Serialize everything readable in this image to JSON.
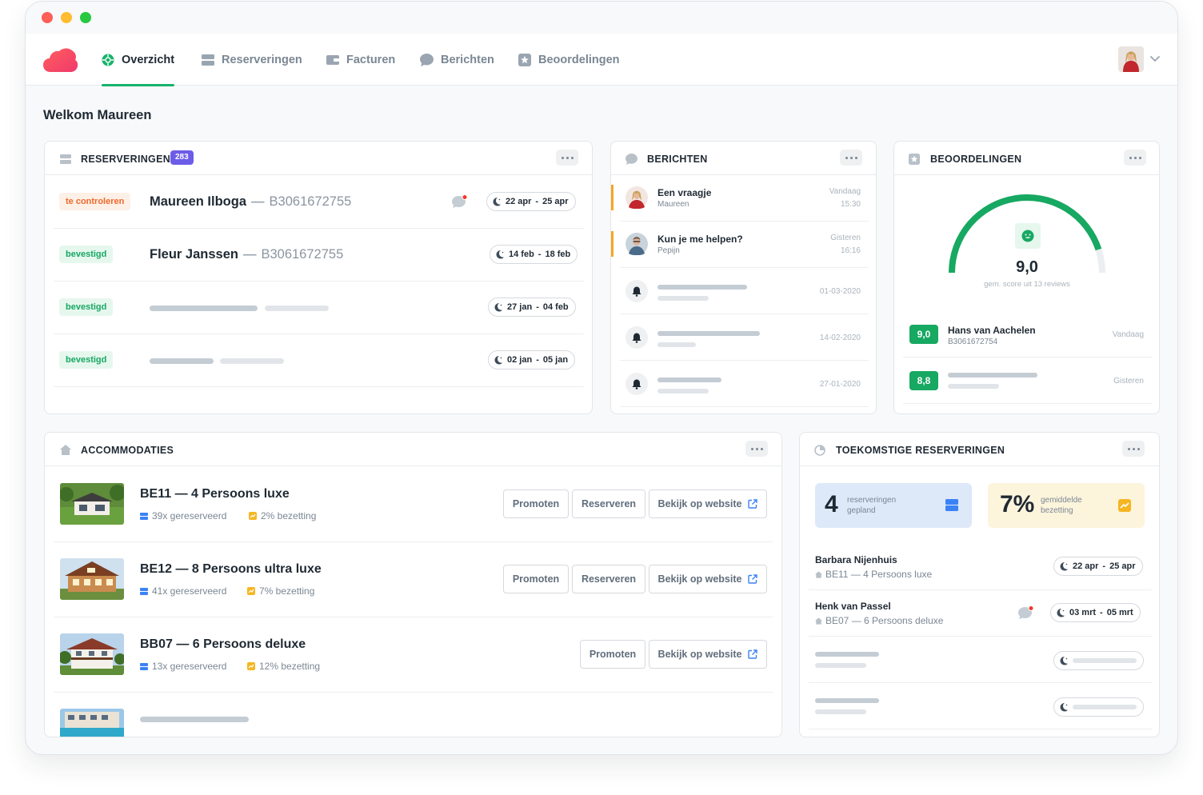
{
  "nav": {
    "tabs": [
      {
        "label": "Overzicht",
        "icon": "dashboard-icon"
      },
      {
        "label": "Reserveringen",
        "icon": "reservations-icon"
      },
      {
        "label": "Facturen",
        "icon": "wallet-icon"
      },
      {
        "label": "Berichten",
        "icon": "chat-icon"
      },
      {
        "label": "Beoordelingen",
        "icon": "star-icon"
      }
    ]
  },
  "welcome": "Welkom Maureen",
  "reservations": {
    "title": "RESERVERINGEN",
    "count": "283",
    "rows": [
      {
        "status": "te controleren",
        "name": "Maureen Ilboga",
        "dash": "—",
        "code": "B3061672755",
        "date_from": "22 apr",
        "date_to": "25 apr"
      },
      {
        "status": "bevestigd",
        "name": "Fleur Janssen",
        "dash": "—",
        "code": "B3061672755",
        "date_from": "14 feb",
        "date_to": "18 feb"
      },
      {
        "status": "bevestigd",
        "date_from": "27 jan",
        "date_to": "04 feb"
      },
      {
        "status": "bevestigd",
        "date_from": "02 jan",
        "date_to": "05 jan"
      }
    ],
    "date_sep": "-"
  },
  "messages": {
    "title": "BERICHTEN",
    "items": [
      {
        "title": "Een vraagje",
        "sender": "Maureen",
        "day": "Vandaag",
        "time": "15:30"
      },
      {
        "title": "Kun je me helpen?",
        "sender": "Pepijn",
        "day": "Gisteren",
        "time": "16:16"
      },
      {
        "date": "01-03-2020"
      },
      {
        "date": "14-02-2020"
      },
      {
        "date": "27-01-2020"
      }
    ]
  },
  "reviews": {
    "title": "BEOORDELINGEN",
    "score": "9,0",
    "score_fraction": 0.9,
    "subtitle": "gem. score uit 13 reviews",
    "items": [
      {
        "score": "9,0",
        "name": "Hans van Aachelen",
        "code": "B3061672754",
        "when": "Vandaag"
      },
      {
        "score": "8,8",
        "when": "Gisteren"
      }
    ],
    "colors": {
      "accent": "#17a862"
    }
  },
  "accommodations": {
    "title": "ACCOMMODATIES",
    "items": [
      {
        "title": "BE11 — 4 Persoons luxe",
        "reserved": "39x gereserveerd",
        "occupancy": "2% bezetting",
        "btn_promote": "Promoten",
        "btn_reserve": "Reserveren",
        "btn_website": "Bekijk op website"
      },
      {
        "title": "BE12 — 8 Persoons ultra luxe",
        "reserved": "41x gereserveerd",
        "occupancy": "7% bezetting",
        "btn_promote": "Promoten",
        "btn_reserve": "Reserveren",
        "btn_website": "Bekijk op website"
      },
      {
        "title": "BB07 — 6 Persoons deluxe",
        "reserved": "13x gereserveerd",
        "occupancy": "12% bezetting",
        "btn_promote": "Promoten",
        "btn_website": "Bekijk op website"
      }
    ]
  },
  "future": {
    "title": "TOEKOMSTIGE RESERVERINGEN",
    "stat_planned": {
      "value": "4",
      "label_1": "reserveringen",
      "label_2": "gepland"
    },
    "stat_occupancy": {
      "value": "7%",
      "label_1": "gemiddelde",
      "label_2": "bezetting"
    },
    "items": [
      {
        "name": "Barbara Nijenhuis",
        "accommodation": "BE11 — 4 Persoons luxe",
        "date_from": "22 apr",
        "date_to": "25 apr"
      },
      {
        "name": "Henk van Passel",
        "accommodation": "BE07 — 6 Persoons deluxe",
        "date_from": "03 mrt",
        "date_to": "05 mrt"
      }
    ]
  }
}
